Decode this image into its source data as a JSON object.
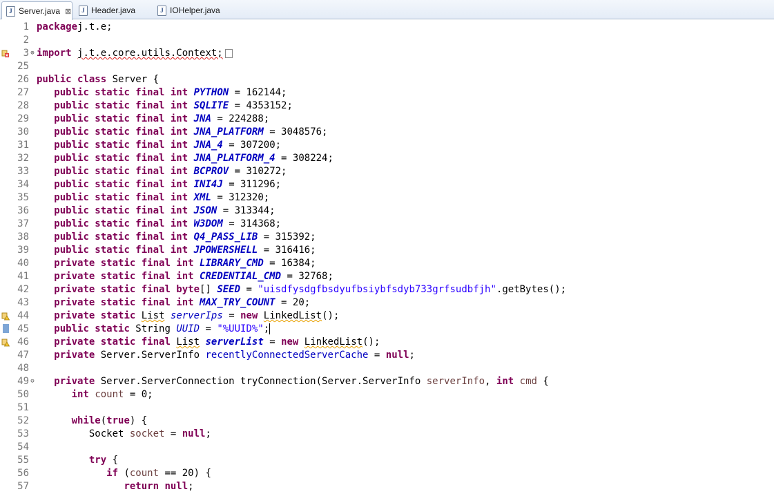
{
  "tabs": [
    {
      "label": "Server.java",
      "active": true,
      "close": "⊠"
    },
    {
      "label": "Header.java",
      "active": false
    },
    {
      "label": "IOHelper.java",
      "active": false
    }
  ],
  "lines": [
    {
      "n": "1",
      "segs": [
        [
          "kw",
          "package"
        ],
        [
          "",
          "j.t.e;"
        ]
      ]
    },
    {
      "n": "2",
      "segs": []
    },
    {
      "n": "3",
      "fold": "⊕",
      "marker": "error",
      "segs": [
        [
          "kw",
          "import"
        ],
        [
          "",
          " "
        ],
        [
          "wvr",
          "j.t.e.core.utils.Context;"
        ]
      ],
      "collapsed": true
    },
    {
      "n": "25",
      "segs": []
    },
    {
      "n": "26",
      "segs": [
        [
          "kw",
          "public class"
        ],
        [
          "",
          " Server {"
        ]
      ]
    },
    {
      "n": "27",
      "segs": [
        [
          "",
          "   "
        ],
        [
          "kw",
          "public static final int"
        ],
        [
          "",
          " "
        ],
        [
          "cst",
          "PYTHON"
        ],
        [
          "",
          " = 162144;"
        ]
      ]
    },
    {
      "n": "28",
      "segs": [
        [
          "",
          "   "
        ],
        [
          "kw",
          "public static final int"
        ],
        [
          "",
          " "
        ],
        [
          "cst",
          "SQLITE"
        ],
        [
          "",
          " = 4353152;"
        ]
      ]
    },
    {
      "n": "29",
      "segs": [
        [
          "",
          "   "
        ],
        [
          "kw",
          "public static final int"
        ],
        [
          "",
          " "
        ],
        [
          "cst",
          "JNA"
        ],
        [
          "",
          " = 224288;"
        ]
      ]
    },
    {
      "n": "30",
      "segs": [
        [
          "",
          "   "
        ],
        [
          "kw",
          "public static final int"
        ],
        [
          "",
          " "
        ],
        [
          "cst",
          "JNA_PLATFORM"
        ],
        [
          "",
          " = 3048576;"
        ]
      ]
    },
    {
      "n": "31",
      "segs": [
        [
          "",
          "   "
        ],
        [
          "kw",
          "public static final int"
        ],
        [
          "",
          " "
        ],
        [
          "cst",
          "JNA_4"
        ],
        [
          "",
          " = 307200;"
        ]
      ]
    },
    {
      "n": "32",
      "segs": [
        [
          "",
          "   "
        ],
        [
          "kw",
          "public static final int"
        ],
        [
          "",
          " "
        ],
        [
          "cst",
          "JNA_PLATFORM_4"
        ],
        [
          "",
          " = 308224;"
        ]
      ]
    },
    {
      "n": "33",
      "segs": [
        [
          "",
          "   "
        ],
        [
          "kw",
          "public static final int"
        ],
        [
          "",
          " "
        ],
        [
          "cst",
          "BCPROV"
        ],
        [
          "",
          " = 310272;"
        ]
      ]
    },
    {
      "n": "34",
      "segs": [
        [
          "",
          "   "
        ],
        [
          "kw",
          "public static final int"
        ],
        [
          "",
          " "
        ],
        [
          "cst",
          "INI4J"
        ],
        [
          "",
          " = 311296;"
        ]
      ]
    },
    {
      "n": "35",
      "segs": [
        [
          "",
          "   "
        ],
        [
          "kw",
          "public static final int"
        ],
        [
          "",
          " "
        ],
        [
          "cst",
          "XML"
        ],
        [
          "",
          " = 312320;"
        ]
      ]
    },
    {
      "n": "36",
      "segs": [
        [
          "",
          "   "
        ],
        [
          "kw",
          "public static final int"
        ],
        [
          "",
          " "
        ],
        [
          "cst",
          "JSON"
        ],
        [
          "",
          " = 313344;"
        ]
      ]
    },
    {
      "n": "37",
      "segs": [
        [
          "",
          "   "
        ],
        [
          "kw",
          "public static final int"
        ],
        [
          "",
          " "
        ],
        [
          "cst",
          "W3DOM"
        ],
        [
          "",
          " = 314368;"
        ]
      ]
    },
    {
      "n": "38",
      "segs": [
        [
          "",
          "   "
        ],
        [
          "kw",
          "public static final int"
        ],
        [
          "",
          " "
        ],
        [
          "cst",
          "Q4_PASS_LIB"
        ],
        [
          "",
          " = 315392;"
        ]
      ]
    },
    {
      "n": "39",
      "segs": [
        [
          "",
          "   "
        ],
        [
          "kw",
          "public static final int"
        ],
        [
          "",
          " "
        ],
        [
          "cst",
          "JPOWERSHELL"
        ],
        [
          "",
          " = 316416;"
        ]
      ]
    },
    {
      "n": "40",
      "segs": [
        [
          "",
          "   "
        ],
        [
          "kw",
          "private static final int"
        ],
        [
          "",
          " "
        ],
        [
          "cst",
          "LIBRARY_CMD"
        ],
        [
          "",
          " = 16384;"
        ]
      ]
    },
    {
      "n": "41",
      "segs": [
        [
          "",
          "   "
        ],
        [
          "kw",
          "private static final int"
        ],
        [
          "",
          " "
        ],
        [
          "cst",
          "CREDENTIAL_CMD"
        ],
        [
          "",
          " = 32768;"
        ]
      ]
    },
    {
      "n": "42",
      "segs": [
        [
          "",
          "   "
        ],
        [
          "kw",
          "private static final byte"
        ],
        [
          "",
          "[] "
        ],
        [
          "cst",
          "SEED"
        ],
        [
          "",
          " = "
        ],
        [
          "str",
          "\"uisdfysdgfbsdyufbsiybfsdyb733grfsudbfjh\""
        ],
        [
          "",
          ".getBytes();"
        ]
      ]
    },
    {
      "n": "43",
      "segs": [
        [
          "",
          "   "
        ],
        [
          "kw",
          "private static final int"
        ],
        [
          "",
          " "
        ],
        [
          "cst",
          "MAX_TRY_COUNT"
        ],
        [
          "",
          " = 20;"
        ]
      ]
    },
    {
      "n": "44",
      "marker": "warning",
      "segs": [
        [
          "",
          "   "
        ],
        [
          "kw",
          "private static"
        ],
        [
          "",
          " "
        ],
        [
          "wv",
          "List"
        ],
        [
          "",
          " "
        ],
        [
          "sf",
          "serverIps"
        ],
        [
          "",
          " = "
        ],
        [
          "kw",
          "new"
        ],
        [
          "",
          " "
        ],
        [
          "wv",
          "LinkedList"
        ],
        [
          "",
          "();"
        ]
      ]
    },
    {
      "n": "45",
      "marker": "bookmark",
      "current": true,
      "segs": [
        [
          "",
          "   "
        ],
        [
          "kw",
          "public static"
        ],
        [
          "",
          " String "
        ],
        [
          "sf",
          "UUID"
        ],
        [
          "",
          " = "
        ],
        [
          "str",
          "\"%UUID%\""
        ],
        [
          "",
          ";"
        ]
      ]
    },
    {
      "n": "46",
      "marker": "warning",
      "segs": [
        [
          "",
          "   "
        ],
        [
          "kw",
          "private static final"
        ],
        [
          "",
          " "
        ],
        [
          "wv",
          "List"
        ],
        [
          "",
          " "
        ],
        [
          "cst",
          "serverList"
        ],
        [
          "",
          " = "
        ],
        [
          "kw",
          "new"
        ],
        [
          "",
          " "
        ],
        [
          "wv",
          "LinkedList"
        ],
        [
          "",
          "();"
        ]
      ]
    },
    {
      "n": "47",
      "segs": [
        [
          "",
          "   "
        ],
        [
          "kw",
          "private"
        ],
        [
          "",
          " Server.ServerInfo "
        ],
        [
          "fld",
          "recentlyConnectedServerCache"
        ],
        [
          "",
          " = "
        ],
        [
          "kw",
          "null"
        ],
        [
          "",
          ";"
        ]
      ]
    },
    {
      "n": "48",
      "segs": []
    },
    {
      "n": "49",
      "fold": "⊖",
      "segs": [
        [
          "",
          "   "
        ],
        [
          "kw",
          "private"
        ],
        [
          "",
          " Server.ServerConnection tryConnection(Server.ServerInfo "
        ],
        [
          "prm",
          "serverInfo"
        ],
        [
          "",
          ", "
        ],
        [
          "kw",
          "int"
        ],
        [
          "",
          " "
        ],
        [
          "prm",
          "cmd"
        ],
        [
          "",
          " {"
        ]
      ]
    },
    {
      "n": "50",
      "segs": [
        [
          "",
          "      "
        ],
        [
          "kw",
          "int"
        ],
        [
          "",
          " "
        ],
        [
          "prm",
          "count"
        ],
        [
          "",
          " = 0;"
        ]
      ]
    },
    {
      "n": "51",
      "segs": []
    },
    {
      "n": "52",
      "segs": [
        [
          "",
          "      "
        ],
        [
          "kw",
          "while"
        ],
        [
          "",
          "("
        ],
        [
          "kw",
          "true"
        ],
        [
          "",
          ") {"
        ]
      ]
    },
    {
      "n": "53",
      "segs": [
        [
          "",
          "         Socket "
        ],
        [
          "prm",
          "socket"
        ],
        [
          "",
          " = "
        ],
        [
          "kw",
          "null"
        ],
        [
          "",
          ";"
        ]
      ]
    },
    {
      "n": "54",
      "segs": []
    },
    {
      "n": "55",
      "segs": [
        [
          "",
          "         "
        ],
        [
          "kw",
          "try"
        ],
        [
          "",
          " {"
        ]
      ]
    },
    {
      "n": "56",
      "segs": [
        [
          "",
          "            "
        ],
        [
          "kw",
          "if"
        ],
        [
          "",
          " ("
        ],
        [
          "prm",
          "count"
        ],
        [
          "",
          " == 20) {"
        ]
      ]
    },
    {
      "n": "57",
      "segs": [
        [
          "",
          "               "
        ],
        [
          "kw",
          "return null"
        ],
        [
          "",
          ";"
        ]
      ]
    }
  ]
}
